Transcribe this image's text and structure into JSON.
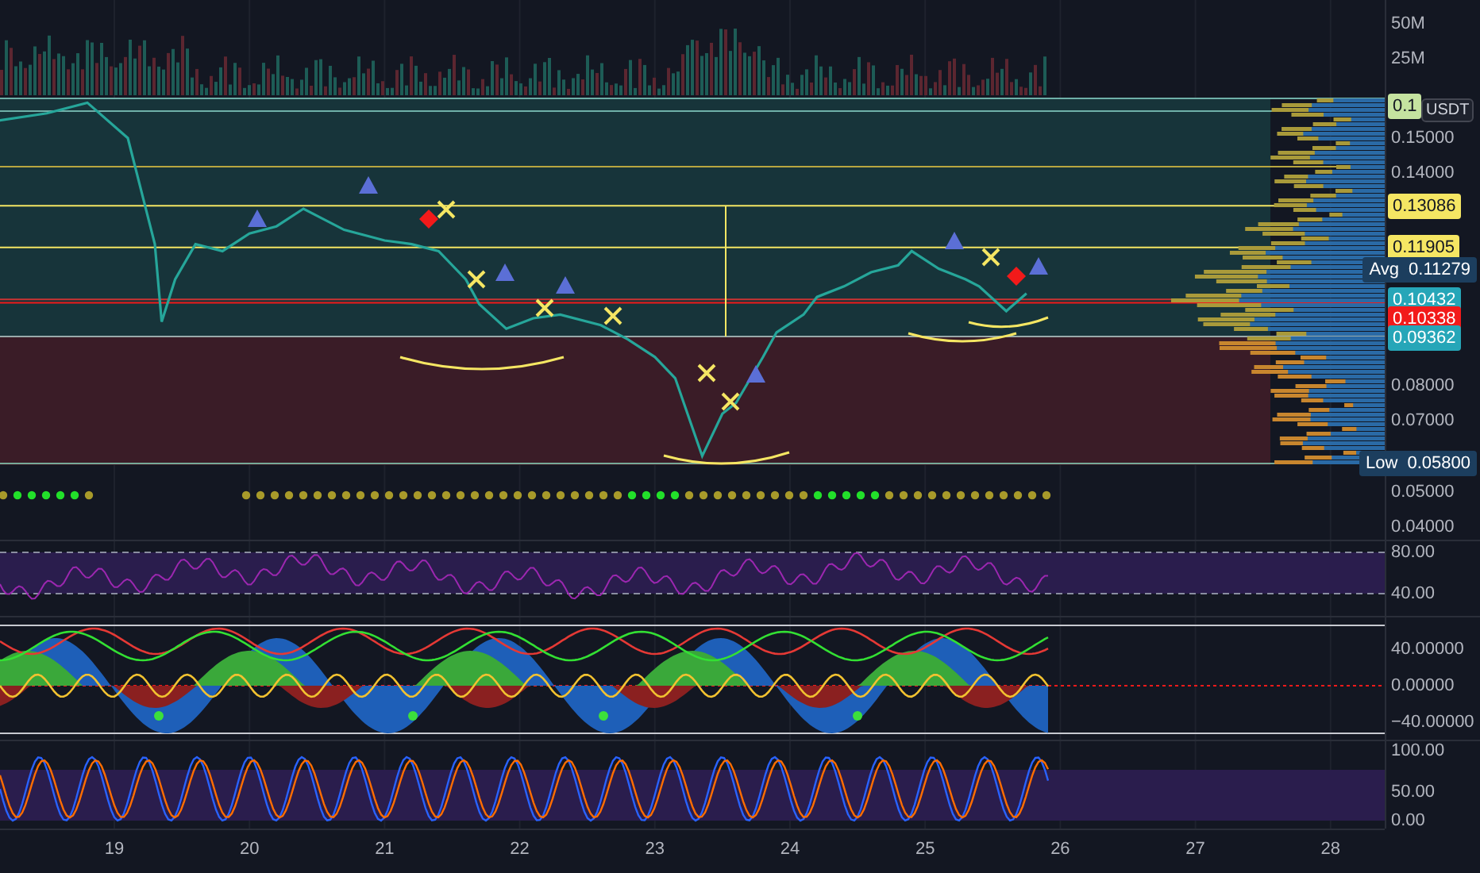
{
  "volume_axis": {
    "ticks": [
      "50M",
      "25M"
    ]
  },
  "price_chart": {
    "unit_badge": "USDT",
    "top_label": {
      "text": "0.1",
      "color": "#c5e3a0"
    },
    "price_axis": {
      "ticks": [
        "0.15000",
        "0.14000",
        "0.08000",
        "0.07000",
        "0.05000",
        "0.04000"
      ]
    },
    "price_labels": [
      {
        "kind": "level",
        "text": "0.13086",
        "color": "#f5e663"
      },
      {
        "kind": "level",
        "text": "0.11905",
        "color": "#f5e663"
      },
      {
        "kind": "tagged",
        "tag": "Avg",
        "text": "0.11279",
        "color": "#1c3e5e"
      },
      {
        "kind": "level",
        "text": "0.10432",
        "color": "#26a6b8"
      },
      {
        "kind": "level",
        "text": "0.10338",
        "color": "#f21a1a"
      },
      {
        "kind": "level",
        "text": "0.09362",
        "color": "#26a6b8"
      },
      {
        "kind": "tagged",
        "tag": "Low",
        "text": "0.05800",
        "color": "#1c3e5e"
      }
    ]
  },
  "rsi": {
    "ticks": [
      "80.00",
      "40.00"
    ]
  },
  "oscillator": {
    "ticks": [
      "40.00000",
      "0.00000",
      "−40.00000"
    ]
  },
  "stochastic": {
    "ticks": [
      "100.00",
      "50.00",
      "0.00"
    ]
  },
  "time_axis": {
    "ticks": [
      "19",
      "20",
      "21",
      "22",
      "23",
      "24",
      "25",
      "26",
      "27",
      "28"
    ]
  }
}
